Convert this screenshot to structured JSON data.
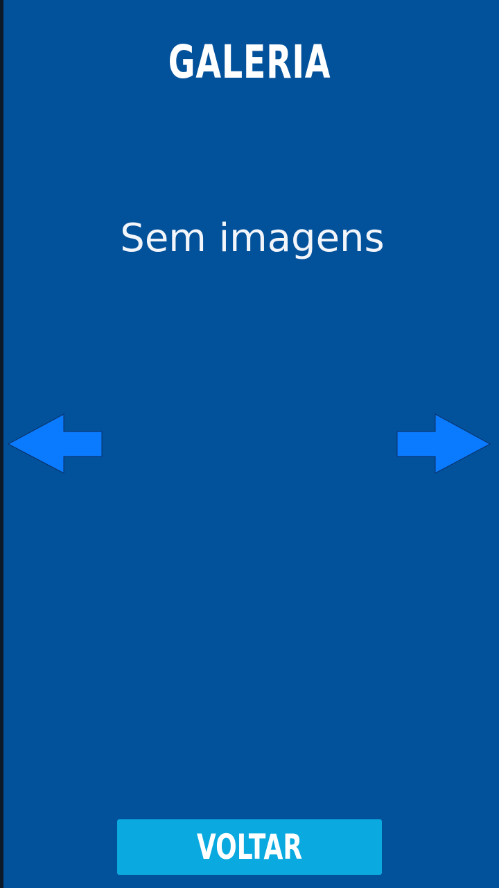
{
  "screen": {
    "title": "GALERIA",
    "empty_message": "Sem imagens",
    "back_label": "VOLTAR"
  },
  "icons": {
    "previous": "arrow-left-icon",
    "next": "arrow-right-icon"
  },
  "colors": {
    "background": "#02519B",
    "arrow": "#0A7BFF",
    "button": "#0AAAE0",
    "text": "#FFFFFF"
  }
}
